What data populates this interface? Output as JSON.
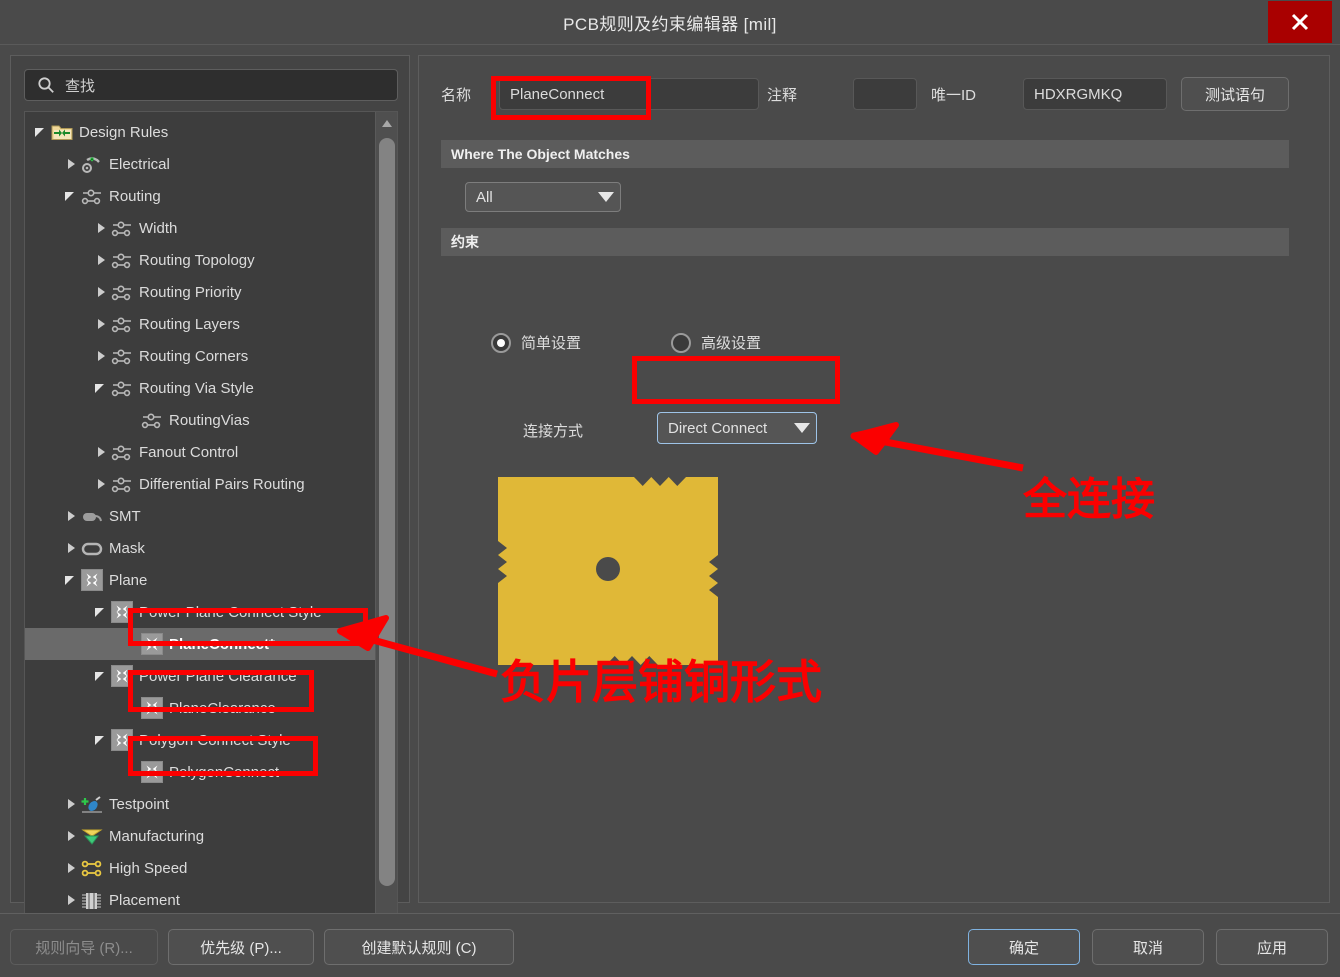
{
  "window": {
    "title": "PCB规则及约束编辑器 [mil]",
    "close_icon": "close-icon"
  },
  "search": {
    "placeholder": "查找",
    "icon": "search-icon"
  },
  "tree": {
    "items": [
      {
        "label": "Design Rules",
        "depth": 0,
        "twisty": "open",
        "icon": "design-rules-folder-icon",
        "selected": false
      },
      {
        "label": "Electrical",
        "depth": 1,
        "twisty": "closed",
        "icon": "electrical-icon",
        "selected": false
      },
      {
        "label": "Routing",
        "depth": 1,
        "twisty": "open",
        "icon": "routing-icon",
        "selected": false
      },
      {
        "label": "Width",
        "depth": 2,
        "twisty": "closed",
        "icon": "routing-icon",
        "selected": false
      },
      {
        "label": "Routing Topology",
        "depth": 2,
        "twisty": "closed",
        "icon": "routing-icon",
        "selected": false
      },
      {
        "label": "Routing Priority",
        "depth": 2,
        "twisty": "closed",
        "icon": "routing-icon",
        "selected": false
      },
      {
        "label": "Routing Layers",
        "depth": 2,
        "twisty": "closed",
        "icon": "routing-icon",
        "selected": false
      },
      {
        "label": "Routing Corners",
        "depth": 2,
        "twisty": "closed",
        "icon": "routing-icon",
        "selected": false
      },
      {
        "label": "Routing Via Style",
        "depth": 2,
        "twisty": "open",
        "icon": "routing-icon",
        "selected": false
      },
      {
        "label": "RoutingVias",
        "depth": 3,
        "twisty": "none",
        "icon": "routing-icon",
        "selected": false
      },
      {
        "label": "Fanout Control",
        "depth": 2,
        "twisty": "closed",
        "icon": "routing-icon",
        "selected": false
      },
      {
        "label": "Differential Pairs Routing",
        "depth": 2,
        "twisty": "closed",
        "icon": "routing-icon",
        "selected": false
      },
      {
        "label": "SMT",
        "depth": 1,
        "twisty": "closed",
        "icon": "smt-icon",
        "selected": false
      },
      {
        "label": "Mask",
        "depth": 1,
        "twisty": "closed",
        "icon": "mask-icon",
        "selected": false
      },
      {
        "label": "Plane",
        "depth": 1,
        "twisty": "open",
        "icon": "plane-icon",
        "selected": false
      },
      {
        "label": "Power Plane Connect Style",
        "depth": 2,
        "twisty": "open",
        "icon": "plane-icon",
        "selected": false
      },
      {
        "label": "PlaneConnect*",
        "depth": 3,
        "twisty": "none",
        "icon": "plane-icon",
        "selected": true
      },
      {
        "label": "Power Plane Clearance",
        "depth": 2,
        "twisty": "open",
        "icon": "plane-icon",
        "selected": false
      },
      {
        "label": "PlaneClearance",
        "depth": 3,
        "twisty": "none",
        "icon": "plane-icon",
        "selected": false
      },
      {
        "label": "Polygon Connect Style",
        "depth": 2,
        "twisty": "open",
        "icon": "plane-icon",
        "selected": false
      },
      {
        "label": "PolygonConnect",
        "depth": 3,
        "twisty": "none",
        "icon": "plane-icon",
        "selected": false
      },
      {
        "label": "Testpoint",
        "depth": 1,
        "twisty": "closed",
        "icon": "testpoint-icon",
        "selected": false
      },
      {
        "label": "Manufacturing",
        "depth": 1,
        "twisty": "closed",
        "icon": "manufacturing-icon",
        "selected": false
      },
      {
        "label": "High Speed",
        "depth": 1,
        "twisty": "closed",
        "icon": "high-speed-icon",
        "selected": false
      },
      {
        "label": "Placement",
        "depth": 1,
        "twisty": "closed",
        "icon": "placement-icon",
        "selected": false
      }
    ],
    "scrollbar": {
      "up_icon": "scroll-up-icon",
      "down_icon": "scroll-down-icon"
    }
  },
  "form": {
    "name_label": "名称",
    "name_value": "PlaneConnect",
    "comment_label": "注释",
    "comment_value": "",
    "unique_id_label": "唯一ID",
    "unique_id_value": "HDXRGMKQ",
    "test_query_button": "测试语句"
  },
  "where_section": {
    "header": "Where The Object Matches",
    "scope_value": "All",
    "dropdown_icon": "chevron-down-icon"
  },
  "constraints_section": {
    "header": "约束",
    "radio_simple": "简单设置",
    "radio_advanced": "高级设置",
    "selected_radio": "简单设置",
    "connect_label": "连接方式",
    "connect_value": "Direct Connect",
    "dropdown_icon": "chevron-down-icon"
  },
  "preview": {
    "copper_color": "#e0b837",
    "background_color": "#4a4a4a",
    "hole_color": "#4a4a4a"
  },
  "bottom_bar": {
    "rule_wizard": "规则向导 (R)...",
    "priority": "优先级 (P)...",
    "create_default": "创建默认规则 (C)",
    "ok": "确定",
    "cancel": "取消",
    "apply": "应用"
  },
  "annotations": {
    "color": "#fb0000",
    "label_full_connect": "全连接",
    "label_negative_plane": "负片层铺铜形式"
  }
}
